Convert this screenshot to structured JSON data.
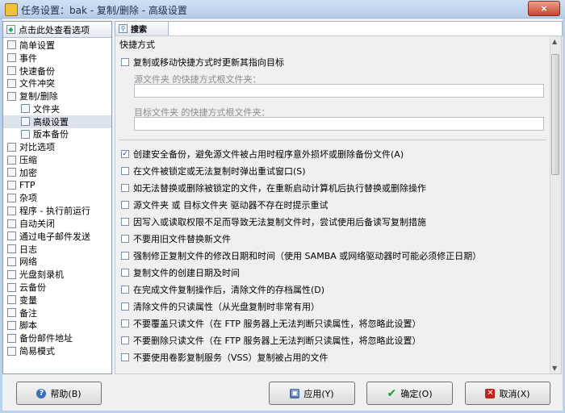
{
  "window": {
    "title": "任务设置：bak - 复制/删除 - 高级设置",
    "close_icon": "×"
  },
  "sidebar": {
    "header": "点击此处查看选项",
    "items": [
      {
        "label": "简单设置",
        "level": 0,
        "selected": false
      },
      {
        "label": "事件",
        "level": 0,
        "selected": false
      },
      {
        "label": "快速备份",
        "level": 0,
        "selected": false
      },
      {
        "label": "文件冲突",
        "level": 0,
        "selected": false
      },
      {
        "label": "复制/删除",
        "level": 0,
        "selected": false
      },
      {
        "label": "文件夹",
        "level": 1,
        "selected": false
      },
      {
        "label": "高级设置",
        "level": 1,
        "selected": true
      },
      {
        "label": "版本备份",
        "level": 1,
        "selected": false
      },
      {
        "label": "对比选项",
        "level": 0,
        "selected": false
      },
      {
        "label": "压缩",
        "level": 0,
        "selected": false
      },
      {
        "label": "加密",
        "level": 0,
        "selected": false
      },
      {
        "label": "FTP",
        "level": 0,
        "selected": false
      },
      {
        "label": "杂项",
        "level": 0,
        "selected": false
      },
      {
        "label": "程序 - 执行前运行",
        "level": 0,
        "selected": false
      },
      {
        "label": "自动关闭",
        "level": 0,
        "selected": false
      },
      {
        "label": "通过电子邮件发送",
        "level": 0,
        "selected": false
      },
      {
        "label": "日志",
        "level": 0,
        "selected": false
      },
      {
        "label": "网络",
        "level": 0,
        "selected": false
      },
      {
        "label": "光盘刻录机",
        "level": 0,
        "selected": false
      },
      {
        "label": "云备份",
        "level": 0,
        "selected": false
      },
      {
        "label": "变量",
        "level": 0,
        "selected": false
      },
      {
        "label": "备注",
        "level": 0,
        "selected": false
      },
      {
        "label": "脚本",
        "level": 0,
        "selected": false
      },
      {
        "label": "备份邮件地址",
        "level": 0,
        "selected": false
      },
      {
        "label": "简易模式",
        "level": 0,
        "selected": false
      }
    ]
  },
  "search_tab": {
    "label": "搜索"
  },
  "panel": {
    "section_title": "快捷方式",
    "shortcut_checkbox": {
      "label": "复制或移动快捷方式时更新其指向目标",
      "checked": false
    },
    "source_root_label": "源文件夹 的快捷方式根文件夹：",
    "source_root_value": "",
    "target_root_label": "目标文件夹 的快捷方式根文件夹：",
    "target_root_value": "",
    "options": [
      {
        "label": "创建安全备份，避免源文件被占用时程序意外损坏或删除备份文件(A)",
        "checked": true
      },
      {
        "label": "在文件被锁定或无法复制时弹出重试窗口(S)",
        "checked": false
      },
      {
        "label": "如无法替换或删除被锁定的文件，在重新启动计算机后执行替换或删除操作",
        "checked": false
      },
      {
        "label": "源文件夹 或 目标文件夹 驱动器不存在时提示重试",
        "checked": false
      },
      {
        "label": "因写入或读取权限不足而导致无法复制文件时，尝试使用后备读写复制措施",
        "checked": false
      },
      {
        "label": "不要用旧文件替换新文件",
        "checked": false
      },
      {
        "label": "强制修正复制文件的修改日期和时间（使用 SAMBA 或网络驱动器时可能必须修正日期）",
        "checked": false
      },
      {
        "label": "复制文件的创建日期及时间",
        "checked": false
      },
      {
        "label": "在完成文件复制操作后，清除文件的存档属性(D)",
        "checked": false
      },
      {
        "label": "清除文件的只读属性（从光盘复制时非常有用）",
        "checked": false
      },
      {
        "label": "不要覆盖只读文件（在 FTP 服务器上无法判断只读属性，将忽略此设置）",
        "checked": false
      },
      {
        "label": "不要删除只读文件（在 FTP 服务器上无法判断只读属性，将忽略此设置）",
        "checked": false
      },
      {
        "label": "不要使用卷影复制服务（VSS）复制被占用的文件",
        "checked": false
      }
    ]
  },
  "buttons": {
    "help": "帮助(B)",
    "apply": "应用(Y)",
    "ok": "确定(O)",
    "cancel": "取消(X)"
  },
  "icons": {
    "help": "help-icon",
    "apply": "save-icon",
    "ok": "checkmark-icon",
    "cancel": "cancel-icon",
    "search": "search-icon"
  },
  "colors": {
    "ok_icon": "#1f9a2b",
    "cancel_icon": "#c0221a",
    "help_icon": "#3b6fb6",
    "selection": "#dde3ea"
  }
}
